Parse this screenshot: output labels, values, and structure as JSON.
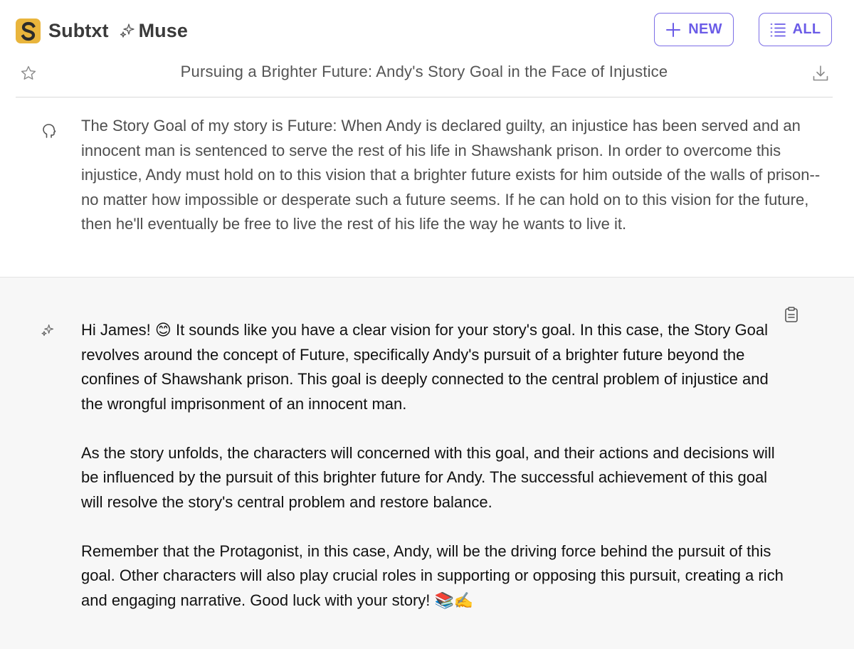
{
  "app": {
    "logo_icon": "subtxt-s-logo",
    "brand_name": "Subtxt",
    "product_name": "Muse",
    "accent_color": "#6b5ce7",
    "logo_color": "#e9b53c"
  },
  "toolbar": {
    "new_label": "NEW",
    "all_label": "ALL"
  },
  "conversation": {
    "title": "Pursuing a Brighter Future: Andy's Story Goal in the Face of Injustice"
  },
  "prompt": {
    "text": "The Story Goal of my story is Future: When Andy is declared guilty, an injustice has been served and an innocent man is sentenced to serve the rest of his life in Shawshank prison. In order to overcome this injustice, Andy must hold on to this vision that a brighter future exists for him outside of the walls of prison--no matter how impossible or desperate such a future seems. If he can hold on to this vision for the future, then he'll eventually be free to live the rest of his life the way he wants to live it."
  },
  "response": {
    "paragraphs": [
      "Hi James! 😊 It sounds like you have a clear vision for your story's goal. In this case, the Story Goal revolves around the concept of Future, specifically Andy's pursuit of a brighter future beyond the confines of Shawshank prison. This goal is deeply connected to the central problem of injustice and the wrongful imprisonment of an innocent man.",
      "As the story unfolds, the characters will concerned with this goal, and their actions and decisions will be influenced by the pursuit of this brighter future for Andy. The successful achievement of this goal will resolve the story's central problem and restore balance.",
      "Remember that the Protagonist, in this case, Andy, will be the driving force behind the pursuit of this goal. Other characters will also play crucial roles in supporting or opposing this pursuit, creating a rich and engaging narrative. Good luck with your story! 📚✍️"
    ]
  }
}
